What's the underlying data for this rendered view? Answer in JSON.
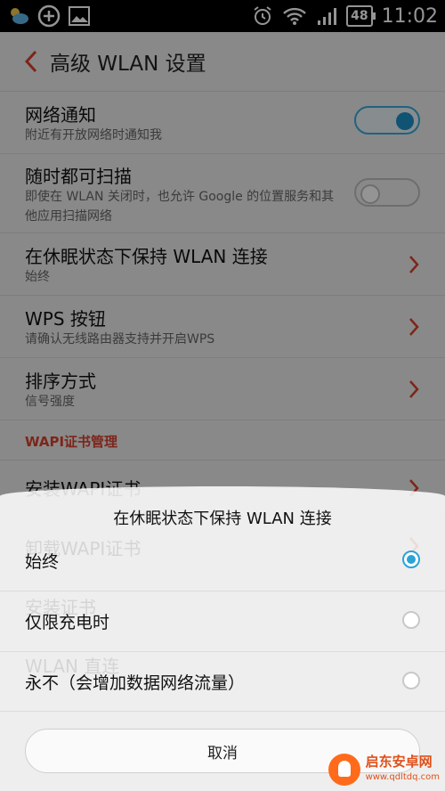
{
  "status_bar": {
    "time": "11:02",
    "battery": "48"
  },
  "header": {
    "title": "高级 WLAN 设置"
  },
  "settings": [
    {
      "title": "网络通知",
      "subtitle": "附近有开放网络时通知我",
      "control": "toggle",
      "state": "on"
    },
    {
      "title": "随时都可扫描",
      "subtitle": "即使在 WLAN 关闭时，也允许 Google 的位置服务和其他应用扫描网络",
      "control": "toggle",
      "state": "off"
    },
    {
      "title": "在休眠状态下保持 WLAN 连接",
      "subtitle": "始终",
      "control": "chevron"
    },
    {
      "title": "WPS 按钮",
      "subtitle": "请确认无线路由器支持并开启WPS",
      "control": "chevron"
    },
    {
      "title": "排序方式",
      "subtitle": "信号强度",
      "control": "chevron"
    }
  ],
  "section": {
    "title": "WAPI证书管理"
  },
  "section_items": [
    "安装WAPI证书",
    "卸载WAPI证书",
    "安装证书",
    "WLAN 直连"
  ],
  "dialog": {
    "title": "在休眠状态下保持 WLAN 连接",
    "options": [
      {
        "label": "始终",
        "selected": true
      },
      {
        "label": "仅限充电时",
        "selected": false
      },
      {
        "label": "永不（会增加数据网络流量）",
        "selected": false
      }
    ],
    "cancel": "取消"
  },
  "watermark": {
    "name": "启东安卓网",
    "url": "www.qdltdq.com"
  },
  "colors": {
    "accent_red": "#d8402e",
    "accent_blue": "#2aa3d7"
  }
}
